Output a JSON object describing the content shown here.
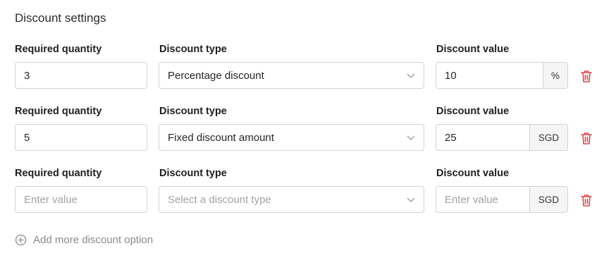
{
  "section_title": "Discount settings",
  "labels": {
    "quantity": "Required quantity",
    "type": "Discount type",
    "value": "Discount value"
  },
  "rows": [
    {
      "quantity": "3",
      "type": "Percentage discount",
      "value": "10",
      "unit": "%"
    },
    {
      "quantity": "5",
      "type": "Fixed discount amount",
      "value": "25",
      "unit": "SGD"
    },
    {
      "quantity_placeholder": "Enter value",
      "type_placeholder": "Select a discount type",
      "value_placeholder": "Enter value",
      "unit": "SGD"
    }
  ],
  "add_option_label": "Add more discount option",
  "icons": {
    "delete": "trash-icon",
    "select": "chevron-down-icon",
    "add": "plus-circle-icon"
  },
  "colors": {
    "delete": "#e0474c",
    "border": "#d3d3d3",
    "muted": "#8a8a8a"
  }
}
